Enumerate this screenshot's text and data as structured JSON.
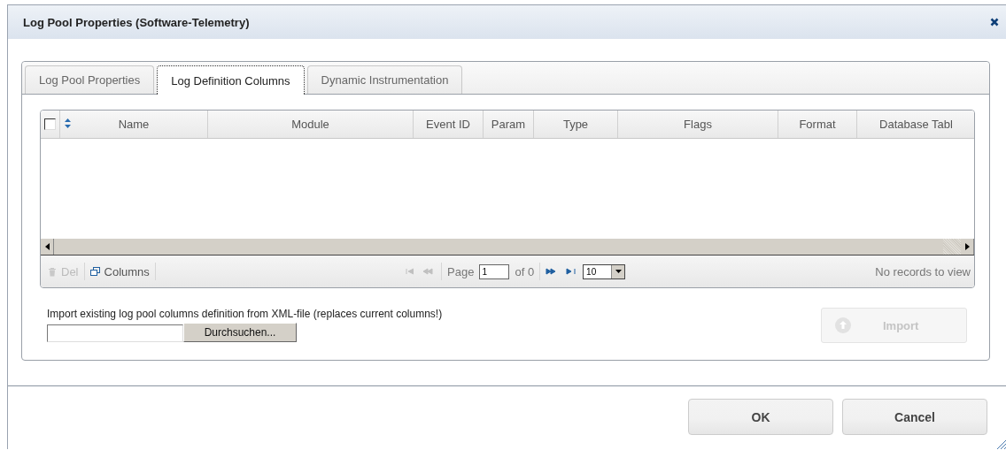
{
  "dialog": {
    "title": "Log Pool Properties (Software-Telemetry)"
  },
  "tabs": [
    {
      "label": "Log Pool Properties",
      "selected": false
    },
    {
      "label": "Log Definition Columns",
      "selected": true
    },
    {
      "label": "Dynamic Instrumentation",
      "selected": false
    }
  ],
  "grid": {
    "select_all": {
      "checked": false
    },
    "columns": [
      {
        "label": "Name",
        "sortable": true
      },
      {
        "label": "Module",
        "sortable": false
      },
      {
        "label": "Event ID",
        "sortable": false
      },
      {
        "label": "Param",
        "sortable": false
      },
      {
        "label": "Type",
        "sortable": false
      },
      {
        "label": "Flags",
        "sortable": false
      },
      {
        "label": "Format",
        "sortable": false
      },
      {
        "label": "Database Tabl",
        "sortable": false
      }
    ],
    "toolbar": [
      {
        "label": "Del",
        "disabled": true,
        "kind": "trash"
      },
      {
        "label": "Columns",
        "disabled": false,
        "kind": "columns"
      }
    ],
    "pager": {
      "page_label": "Page",
      "page": "1",
      "of": "of 0",
      "page_size": "10",
      "status": "No records to view"
    }
  },
  "import": {
    "label": "Import existing log pool columns definition from XML-file (replaces current columns!)",
    "browse": "Durchsuchen...",
    "button": {
      "label": "Import",
      "disabled": true
    }
  },
  "buttons": [
    "OK",
    "Cancel"
  ]
}
